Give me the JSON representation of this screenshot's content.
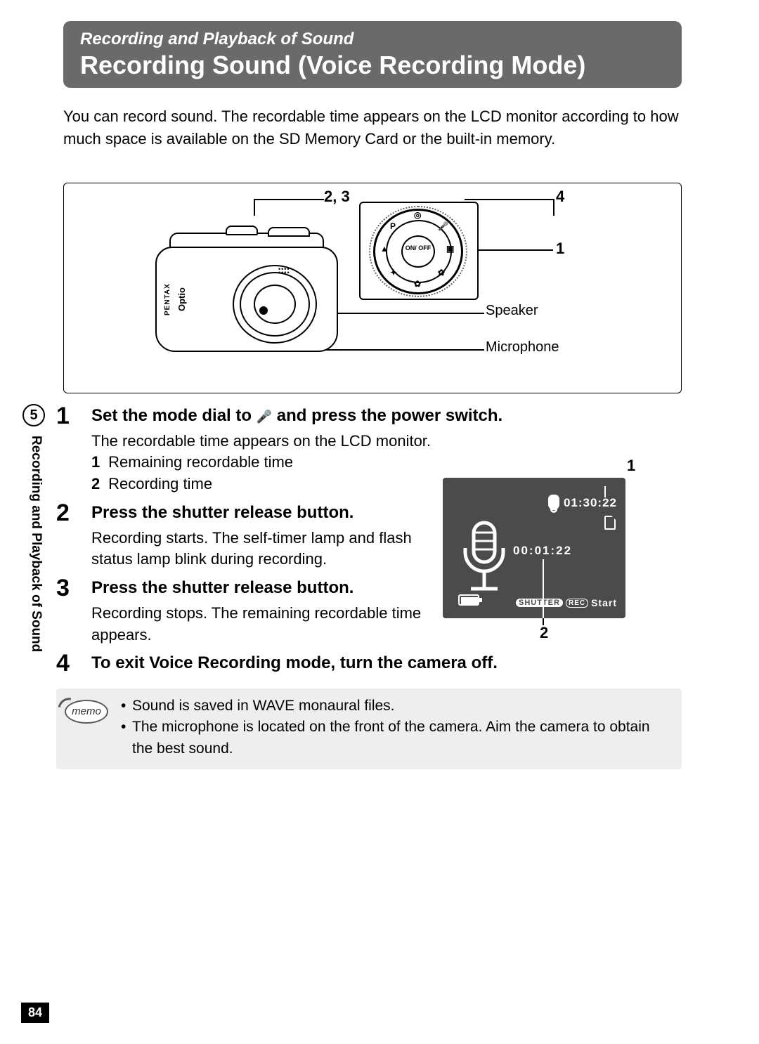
{
  "header": {
    "subtitle": "Recording and Playback of Sound",
    "title": "Recording Sound (Voice Recording Mode)"
  },
  "intro": "You can record sound. The recordable time appears on the LCD monitor according to how much space is available on the SD Memory Card or the built-in memory.",
  "diagram": {
    "callout_23": "2, 3",
    "callout_4": "4",
    "callout_1": "1",
    "speaker_label": "Speaker",
    "mic_label": "Microphone",
    "brand1": "PENTAX",
    "brand2": "Optio",
    "dial_center": "ON/\nOFF"
  },
  "side_tab": {
    "chapter_number": "5",
    "chapter_title": "Recording and Playback of Sound"
  },
  "steps": [
    {
      "num": "1",
      "title_pre": "Set the mode dial to ",
      "title_post": " and press the power switch.",
      "body": "The recordable time appears on the LCD monitor.",
      "sub": [
        {
          "n": "1",
          "t": "Remaining recordable time"
        },
        {
          "n": "2",
          "t": "Recording time"
        }
      ]
    },
    {
      "num": "2",
      "title": "Press the shutter release button.",
      "body": "Recording starts. The self-timer lamp and flash status lamp blink during recording."
    },
    {
      "num": "3",
      "title": "Press the shutter release button.",
      "body": "Recording stops. The remaining recordable time appears."
    },
    {
      "num": "4",
      "title": "To exit Voice Recording mode, turn the camera off."
    }
  ],
  "lcd": {
    "time_remaining": "01:30:22",
    "time_recording": "00:01:22",
    "shutter_pill": "SHUTTER",
    "rec_pill": "REC",
    "start_label": "Start",
    "callout_1": "1",
    "callout_2": "2"
  },
  "memo": {
    "label": "memo",
    "items": [
      "Sound is saved in WAVE monaural files.",
      "The microphone is located on the front of the camera. Aim the camera to obtain the best sound."
    ]
  },
  "page_number": "84"
}
